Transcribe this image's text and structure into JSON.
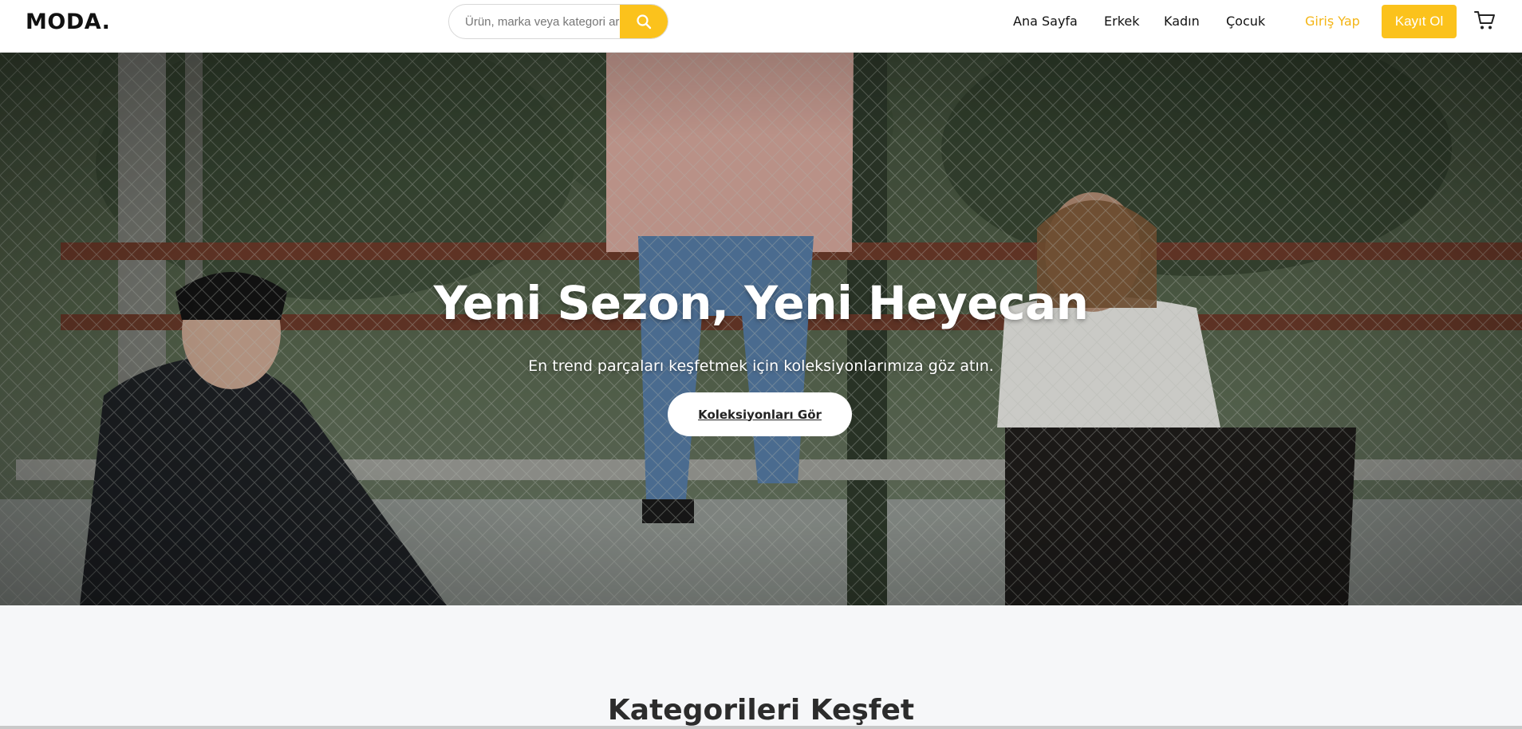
{
  "header": {
    "logo": "MODA.",
    "search": {
      "placeholder": "Ürün, marka veya kategori ara",
      "value": ""
    },
    "nav": [
      {
        "label": "Ana Sayfa"
      },
      {
        "label": "Erkek"
      },
      {
        "label": "Kadın"
      },
      {
        "label": "Çocuk"
      }
    ],
    "login_label": "Giriş Yap",
    "register_label": "Kayıt Ol",
    "icons": {
      "search": "search-icon",
      "cart": "cart-icon"
    }
  },
  "hero": {
    "title": "Yeni Sezon, Yeni Heyecan",
    "subtitle": "En trend parçaları keşfetmek için koleksiyonlarımıza göz atın.",
    "cta_label": "Koleksiyonları Gör"
  },
  "categories": {
    "title": "Kategorileri Keşfet"
  },
  "colors": {
    "accent": "#fbc21c",
    "login_text": "#f4b515",
    "header_bg": "#ffffff",
    "page_bg": "#f6f7f9"
  }
}
